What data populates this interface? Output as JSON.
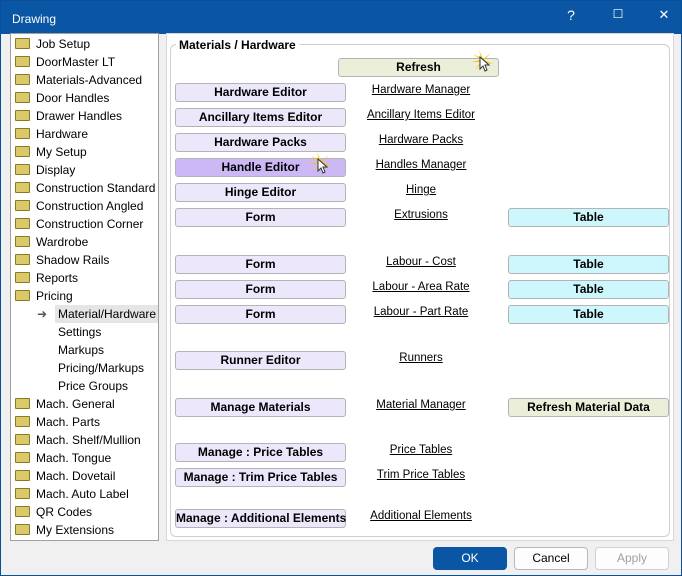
{
  "window": {
    "title": "Drawing",
    "help_icon": "?",
    "maximize_icon": "☐",
    "close_icon": "✕"
  },
  "tree": {
    "items": [
      "Job Setup",
      "DoorMaster LT",
      "Materials-Advanced",
      "Door Handles",
      "Drawer Handles",
      "Hardware",
      "My Setup",
      "Display",
      "Construction Standard",
      "Construction Angled",
      "Construction Corner",
      "Wardrobe",
      "Shadow Rails",
      "Reports",
      "Pricing"
    ],
    "pricing_children": [
      "Material/Hardware",
      "Settings",
      "Markups",
      "Pricing/Markups",
      "Price Groups"
    ],
    "after": [
      "Mach. General",
      "Mach. Parts",
      "Mach. Shelf/Mullion",
      "Mach. Tongue",
      "Mach. Dovetail",
      "Mach. Auto Label",
      "QR Codes",
      "My Extensions"
    ],
    "selected": "Material/Hardware"
  },
  "group": {
    "label": "Materials / Hardware",
    "refresh": "Refresh"
  },
  "rows": [
    {
      "button": "Hardware Editor",
      "link": "Hardware Manager"
    },
    {
      "button": "Ancillary Items Editor",
      "link": "Ancillary Items Editor"
    },
    {
      "button": "Hardware Packs",
      "link": "Hardware Packs"
    },
    {
      "button": "Handle Editor",
      "link": "Handles Manager"
    },
    {
      "button": "Hinge Editor",
      "link": "Hinge"
    },
    {
      "button": "Form",
      "link": "Extrusions",
      "right": "Table"
    },
    {
      "button": "Form",
      "link": "Labour - Cost",
      "right": "Table"
    },
    {
      "button": "Form",
      "link": "Labour - Area Rate",
      "right": "Table"
    },
    {
      "button": "Form",
      "link": "Labour - Part Rate",
      "right": "Table"
    },
    {
      "button": "Runner Editor",
      "link": "Runners"
    },
    {
      "button": "Manage Materials",
      "link": "Material Manager",
      "right": "Refresh Material Data"
    },
    {
      "button": "Manage : Price Tables",
      "link": "Price Tables"
    },
    {
      "button": "Manage : Trim Price Tables",
      "link": "Trim Price Tables"
    },
    {
      "button": "Manage : Additional Elements",
      "link": "Additional Elements"
    }
  ],
  "footer": {
    "ok": "OK",
    "cancel": "Cancel",
    "apply": "Apply"
  },
  "colors": {
    "titlebar": "#0b56a4",
    "button": "#ede7fb",
    "active": "#cbb8f4",
    "table": "#cdf7fd"
  }
}
